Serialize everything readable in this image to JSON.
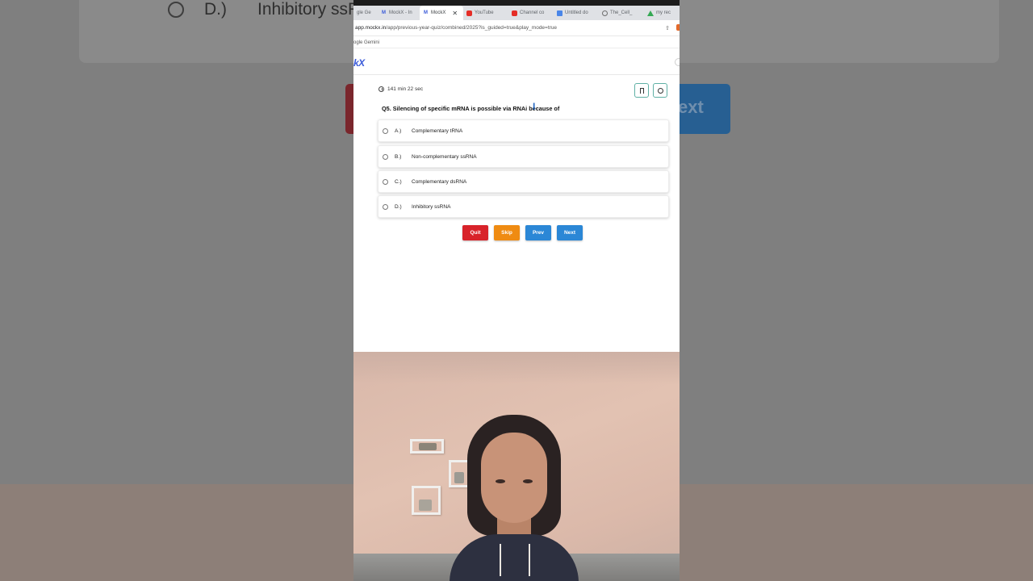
{
  "background": {
    "option_letter": "D.)",
    "option_text": "Inhibitory ssRNA",
    "next_partial": "ext"
  },
  "browser": {
    "tabs": [
      {
        "label": "gle Ge",
        "icon": "gemini-icon",
        "active": false
      },
      {
        "label": "MockX - In",
        "icon": "mockx-icon",
        "active": false
      },
      {
        "label": "MockX",
        "icon": "mockx-icon",
        "active": true
      },
      {
        "label": "YouTube",
        "icon": "youtube-icon",
        "active": false
      },
      {
        "label": "Channel co",
        "icon": "youtube-icon",
        "active": false
      },
      {
        "label": "Untitled do",
        "icon": "docs-icon",
        "active": false
      },
      {
        "label": "The_Cell_",
        "icon": "globe-icon",
        "active": false
      },
      {
        "label": "my rec",
        "icon": "drive-icon",
        "active": false
      }
    ],
    "url_host": "app.mockx.in",
    "url_path": "/app/previous-year-quiz/combined/2025?is_guided=true&play_mode=true",
    "bookmark_label": "ogle Gemini"
  },
  "app": {
    "logo": "kX",
    "timer": "141 min 22 sec",
    "question": "Q5. Silencing of specific mRNA is possible via RNAi because of",
    "options": [
      {
        "letter": "A.)",
        "text": "Complementary tRNA"
      },
      {
        "letter": "B.)",
        "text": "Non-complementary ssRNA"
      },
      {
        "letter": "C.)",
        "text": "Complementary dsRNA"
      },
      {
        "letter": "D.)",
        "text": "Inhibitory ssRNA"
      }
    ],
    "buttons": {
      "quit": "Quit",
      "skip": "Skip",
      "prev": "Prev",
      "next": "Next"
    },
    "colors": {
      "quit": "#d8232a",
      "skip": "#ef8b12",
      "prev": "#2b87d6",
      "next": "#2b87d6",
      "accent": "#3b5bd9"
    }
  }
}
